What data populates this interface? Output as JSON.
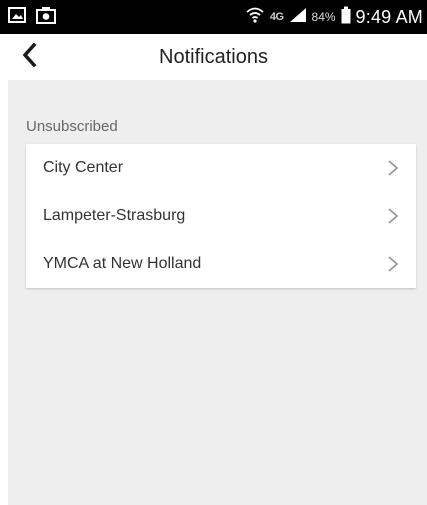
{
  "status_bar": {
    "battery_percent": "84%",
    "time": "9:49 AM",
    "network_label": "4G",
    "icons": [
      "image-icon",
      "camera-icon",
      "wifi-icon",
      "signal-icon",
      "battery-icon"
    ]
  },
  "header": {
    "title": "Notifications",
    "back_icon": "chevron-left-icon"
  },
  "section": {
    "label": "Unsubscribed",
    "items": [
      {
        "label": "City Center",
        "icon": "chevron-right-icon"
      },
      {
        "label": "Lampeter-Strasburg",
        "icon": "chevron-right-icon"
      },
      {
        "label": "YMCA at New Holland",
        "icon": "chevron-right-icon"
      }
    ]
  },
  "colors": {
    "status_bar_bg": "#000000",
    "header_bg": "#ffffff",
    "content_bg": "#eeeeee",
    "card_bg": "#ffffff",
    "chevron": "#999999"
  }
}
